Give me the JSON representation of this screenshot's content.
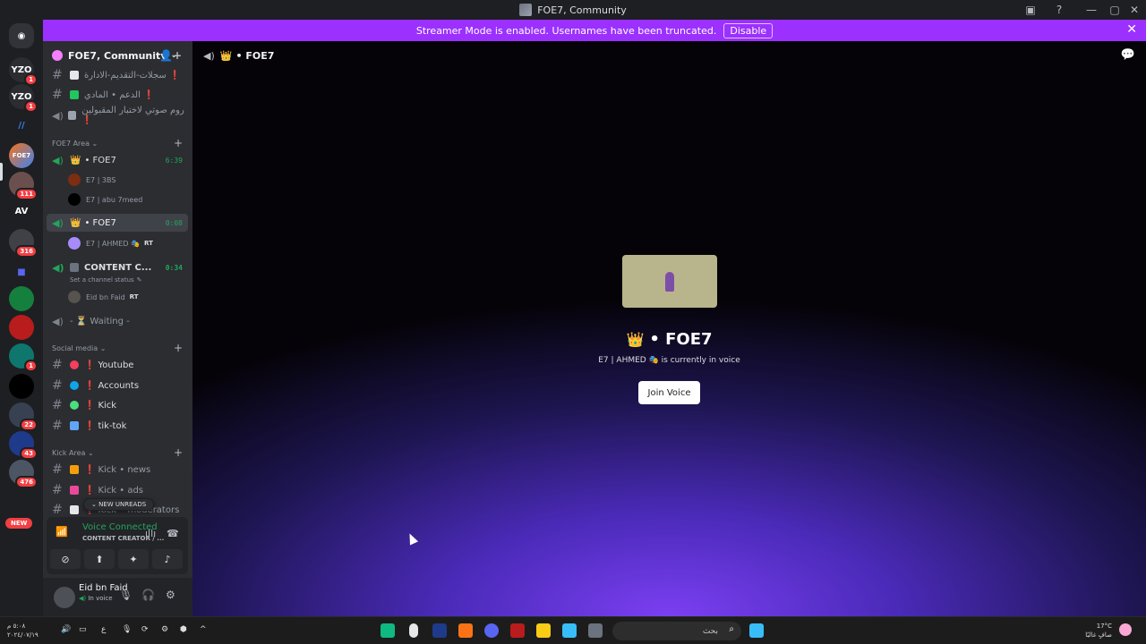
{
  "window": {
    "title": "FOE7, Community"
  },
  "banner": {
    "text": "Streamer Mode is enabled. Usernames have been truncated.",
    "disable_label": "Disable"
  },
  "servers": {
    "items": [
      {
        "label": "YZO",
        "badge": "1"
      },
      {
        "label": "YZO",
        "badge": "1"
      },
      {
        "label": "",
        "badge": ""
      },
      {
        "label": "FOE7",
        "badge": ""
      },
      {
        "label": "",
        "badge": "111"
      },
      {
        "label": "AV",
        "badge": ""
      },
      {
        "label": "",
        "badge": "316"
      },
      {
        "label": "",
        "badge": ""
      },
      {
        "label": "",
        "badge": ""
      },
      {
        "label": "",
        "badge": ""
      },
      {
        "label": "",
        "badge": "1"
      },
      {
        "label": "",
        "badge": ""
      },
      {
        "label": "",
        "badge": "22"
      },
      {
        "label": "",
        "badge": "43"
      },
      {
        "label": "",
        "badge": "476"
      }
    ],
    "new_label": "NEW"
  },
  "sidebar": {
    "server_name": "FOE7, Community",
    "top_channels": [
      {
        "name": "سجلات-التقديم-الادارة ❗"
      },
      {
        "name": "الدعم • المادي ❗"
      },
      {
        "name": "روم صوتي لاختبار المقبولين ❗"
      }
    ],
    "categories": {
      "foe7_area": "FOE7 Area",
      "social_media": "Social media",
      "kick_area": "Kick Area"
    },
    "voice_channels": [
      {
        "name": "• FOE7",
        "time": "6:39"
      },
      {
        "name": "• FOE7",
        "time": "0:08"
      },
      {
        "name": "CONTENT C...",
        "time": "0:34",
        "status": "Set a channel status"
      },
      {
        "name": "- ⏳ Waiting -"
      }
    ],
    "members": [
      {
        "name": "E7 | 3BS"
      },
      {
        "name": "E7 | abu 7meed"
      },
      {
        "name": "E7 | AHMED 🎭",
        "tag": "RT"
      },
      {
        "name": "Eid bn Faid",
        "tag": "RT"
      }
    ],
    "social_channels": [
      {
        "name": "Youtube"
      },
      {
        "name": "Accounts"
      },
      {
        "name": "Kick"
      },
      {
        "name": "tik-tok"
      }
    ],
    "kick_channels": [
      {
        "name": "Kick • news"
      },
      {
        "name": "Kick • ads"
      },
      {
        "name": "Kick • moderators"
      }
    ],
    "new_unreads": "NEW UNREADS"
  },
  "voice_panel": {
    "title": "Voice Connected",
    "channel": "CONTENT CREATOR / ..."
  },
  "user_panel": {
    "name": "Eid bn Faid",
    "status": "In voice"
  },
  "main": {
    "header_title": "• FOE7",
    "channel_title": "• FOE7",
    "subtitle": "E7 | AHMED 🎭 is currently in voice",
    "join_label": "Join Voice"
  },
  "taskbar": {
    "search_placeholder": "بحث",
    "clock_time": "٥:٠٨ م",
    "clock_date": "٢٠٢٤/٠٧/١٩",
    "temp": "17°C",
    "weather": "صافٍ غالبًا",
    "lang": "ع"
  }
}
